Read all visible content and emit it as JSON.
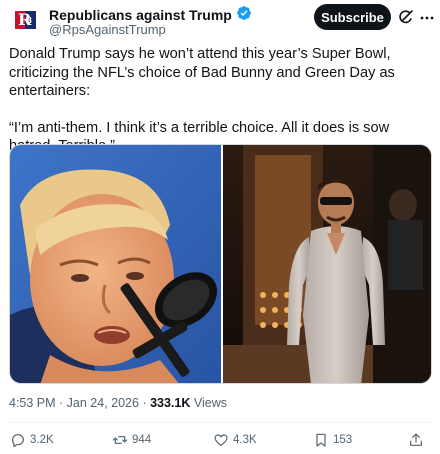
{
  "account": {
    "name": "Republicans against Trump",
    "handle": "@RpsAgainstTrump",
    "avatar_text": "R",
    "verified": true
  },
  "header": {
    "subscribe_label": "Subscribe",
    "grok_icon": "grok-icon",
    "more_icon": "more-icon"
  },
  "tweet": {
    "paragraphs": [
      "Donald Trump says he won’t attend this year’s Super Bowl, criticizing the NFL’s choice of Bad Bunny and Green Day as entertainers:",
      "“I’m anti-them. I think it’s a terrible choice. All it does is sow hatred. Terrible.”"
    ]
  },
  "meta": {
    "time": "4:53 PM",
    "separator": " · ",
    "date": "Jan 24, 2026",
    "views_count": "333.1K",
    "views_label": " Views"
  },
  "actions": {
    "replies": "3.2K",
    "reposts": "944",
    "likes": "4.3K",
    "bookmarks": "153"
  },
  "colors": {
    "accent": "#1d9bf0",
    "text": "#0f1419",
    "secondary": "#536471",
    "subscribe_bg": "#0f1419"
  }
}
